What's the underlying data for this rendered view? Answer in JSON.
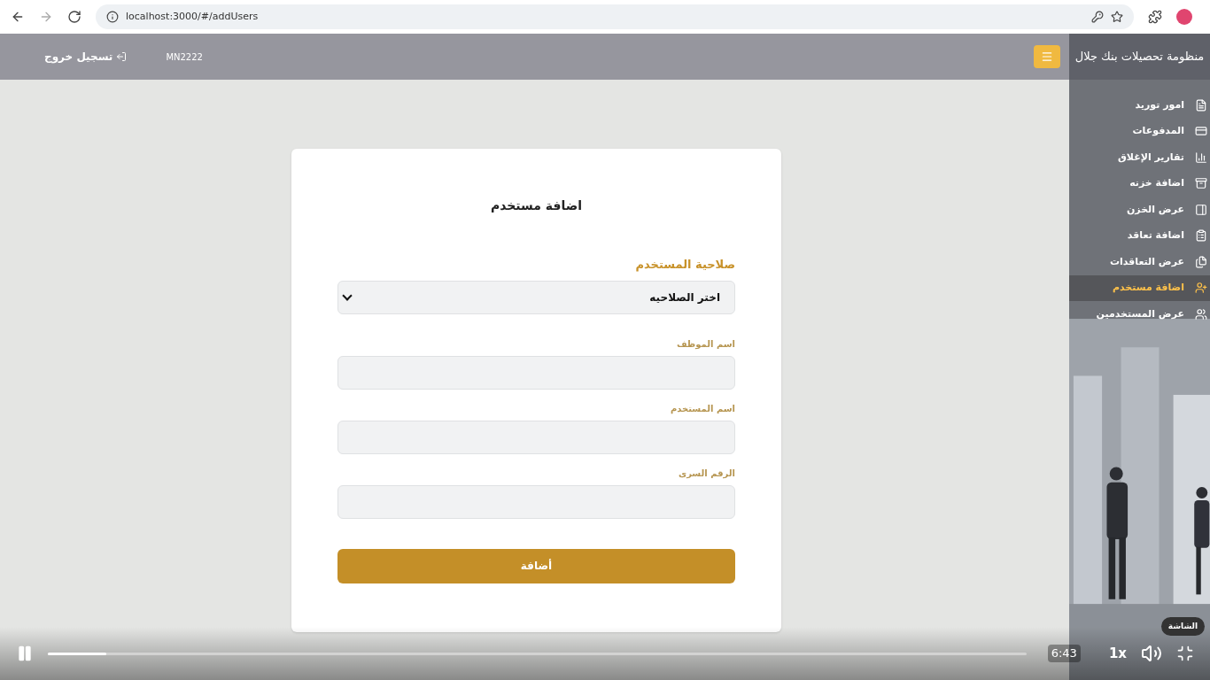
{
  "browser": {
    "url": "localhost:3000/#/addUsers"
  },
  "header": {
    "logout": "تسجيل خروج",
    "user_code": "MN2222"
  },
  "sidebar": {
    "title": "منظومة تحصيلات بنك جلال",
    "items": [
      {
        "label": "امور توريد",
        "selected": false
      },
      {
        "label": "المدفوعات",
        "selected": false
      },
      {
        "label": "تقارير الإغلاق",
        "selected": false
      },
      {
        "label": "اضافة خزنه",
        "selected": false
      },
      {
        "label": "عرض الخزن",
        "selected": false
      },
      {
        "label": "اضافة تعاقد",
        "selected": false
      },
      {
        "label": "عرض التعاقدات",
        "selected": false
      },
      {
        "label": "اضافة مستخدم",
        "selected": true
      },
      {
        "label": "عرض المستخدمين",
        "selected": false
      }
    ]
  },
  "form": {
    "title": "اضافة مستخدم",
    "role_label": "صلاحية المستخدم",
    "role_select": "اختر الصلاحيه",
    "fields": [
      {
        "label": "اسم الموظف"
      },
      {
        "label": "اسم المستخدم"
      },
      {
        "label": "الرقم السرى"
      }
    ],
    "submit": "أضافة"
  },
  "video": {
    "playing": true,
    "level": 0.06,
    "time": "6:43",
    "speed": "1x",
    "tooltip": "الشاشة"
  }
}
